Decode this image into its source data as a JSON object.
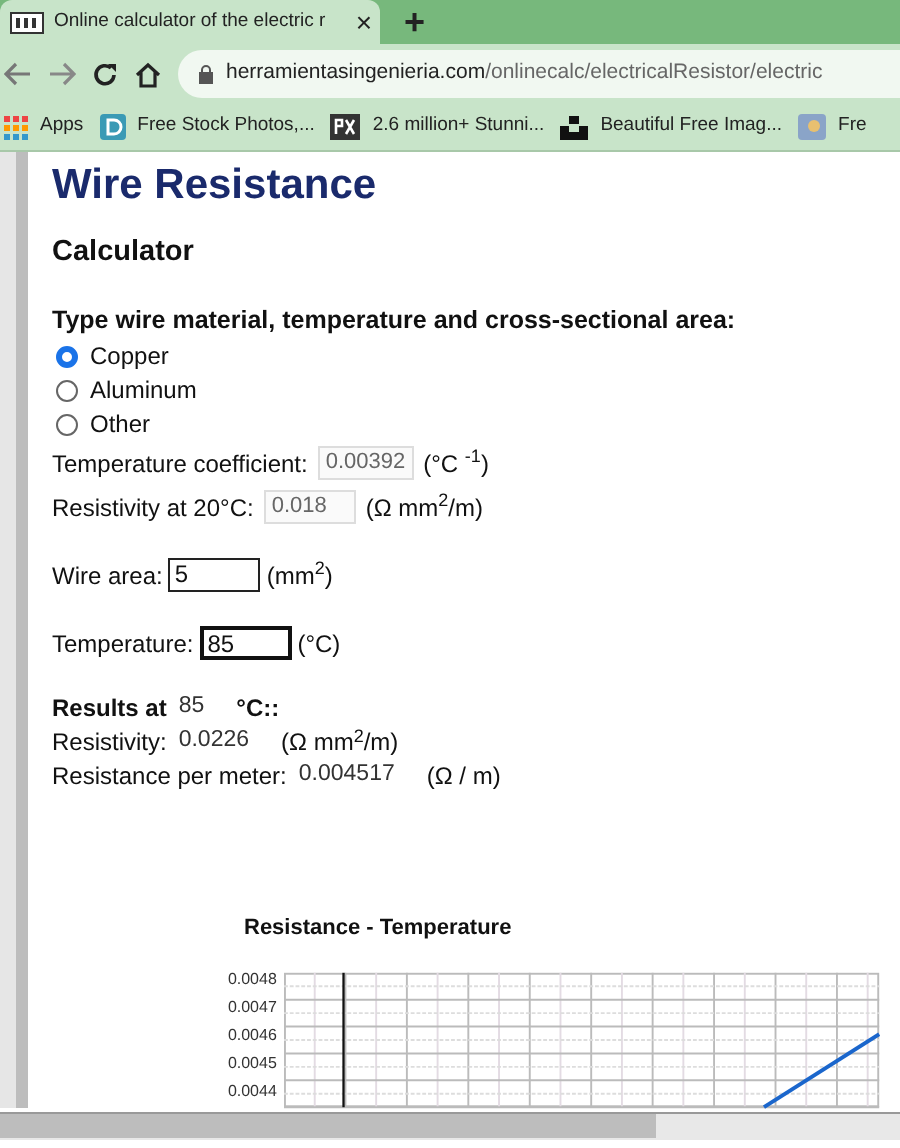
{
  "browser": {
    "tab": {
      "title": "Online calculator of the electric r",
      "close": "×"
    },
    "new_tab": "+",
    "url": {
      "domain": "herramientasingenieria.com",
      "path": "/onlinecalc/electricalResistor/electric"
    },
    "bookmarks": [
      {
        "label": "Apps",
        "kind": "apps"
      },
      {
        "label": "Free Stock Photos,...",
        "kind": "d"
      },
      {
        "label": "2.6 million+ Stunni...",
        "kind": "px"
      },
      {
        "label": "Beautiful Free Imag...",
        "kind": "unsplash"
      },
      {
        "label": "Fre",
        "kind": "other"
      }
    ]
  },
  "page": {
    "title": "Wire Resistance",
    "subtitle": "Calculator",
    "prompt": "Type wire material, temperature and cross-sectional area:",
    "materials": [
      {
        "label": "Copper",
        "selected": true
      },
      {
        "label": "Aluminum",
        "selected": false
      },
      {
        "label": "Other",
        "selected": false
      }
    ],
    "coefficient": {
      "label": "Temperature coefficient:",
      "value": "0.00392",
      "unit": "(°C $^{-1}$)"
    },
    "resistivity_input": {
      "label": "Resistivity at 20°C:",
      "value": "0.018",
      "unit": "(Ω mm$^{2}$/m)"
    },
    "wire_area": {
      "label": "Wire area:",
      "value": "5",
      "unit": "(mm$^{2}$)"
    },
    "temperature": {
      "label": "Temperature:",
      "value": "85",
      "unit": "(°C)"
    },
    "results": {
      "label": "Results at",
      "temperature": "85",
      "unit": "°C::",
      "rows": [
        {
          "label": "Resistivity:",
          "value": "0.0226",
          "unit": "(Ω mm$^{2}$/m)"
        },
        {
          "label": "Resistance per meter:",
          "value": "0.004517",
          "unit": "(Ω / m)"
        }
      ]
    },
    "chart": {
      "title": "Resistance - Temperature",
      "y_labels": [
        "0.0048",
        "0.0047",
        "0.0046",
        "0.0045",
        "0.0044"
      ]
    }
  }
}
